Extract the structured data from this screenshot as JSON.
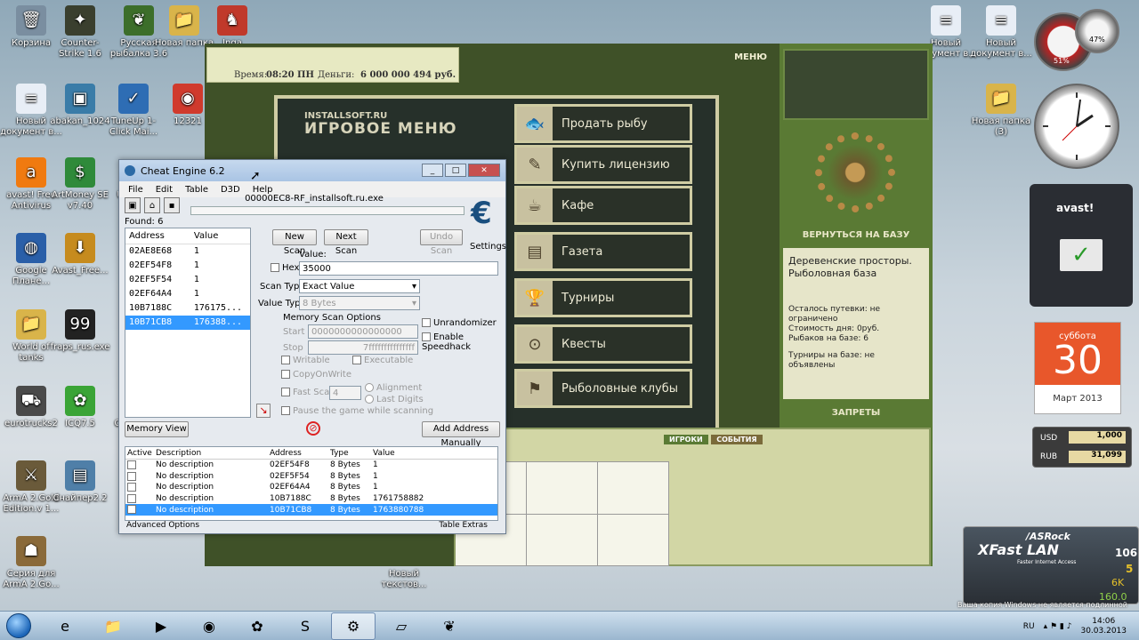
{
  "desktop_icons": [
    {
      "label": "Корзина",
      "glyph": "🗑",
      "color": "#7a8ea0"
    },
    {
      "label": "Counter-Strike 1.6",
      "glyph": "✦",
      "color": "#3a3f2e"
    },
    {
      "label": "Русская рыбалка 3.6",
      "glyph": "❦",
      "color": "#3c6e2a"
    },
    {
      "label": "Новая папка",
      "glyph": "📁",
      "color": "#d9b44a"
    },
    {
      "label": "Inga",
      "glyph": "♞",
      "color": "#c0392b"
    },
    {
      "label": "Новый документ в...",
      "glyph": "≡",
      "color": "#e8eef6"
    },
    {
      "label": "abakan_1024",
      "glyph": "▣",
      "color": "#3a7ca8"
    },
    {
      "label": "TuneUp 1-Click Mai...",
      "glyph": "✓",
      "color": "#2e6db4"
    },
    {
      "label": "12321",
      "glyph": "◉",
      "color": "#d03a2d"
    },
    {
      "label": "avast! Free Antivirus",
      "glyph": "a",
      "color": "#f07a10"
    },
    {
      "label": "ArtMoney SE v7.40",
      "glyph": "$",
      "color": "#2f8a3a"
    },
    {
      "label": "U",
      "glyph": "",
      "color": "transparent"
    },
    {
      "label": "Google Плане...",
      "glyph": "◍",
      "color": "#2a5fa8"
    },
    {
      "label": "Avast_Free...",
      "glyph": "⬇",
      "color": "#c68b1e"
    },
    {
      "label": "World of tanks",
      "glyph": "📁",
      "color": "#d9b44a"
    },
    {
      "label": "fraps_rus.exe",
      "glyph": "99",
      "color": "#222"
    },
    {
      "label": "eurotrucks2",
      "glyph": "⛟",
      "color": "#4a4a4a"
    },
    {
      "label": "ICQ7.5",
      "glyph": "✿",
      "color": "#3aa436"
    },
    {
      "label": "Ch",
      "glyph": "",
      "color": "transparent"
    },
    {
      "label": "ArmA 2.Gold Edition.v 1...",
      "glyph": "⚔",
      "color": "#6a5a3a"
    },
    {
      "label": "Снайпер2.2",
      "glyph": "▤",
      "color": "#4f7fa8"
    },
    {
      "label": "Серия для ArmA 2.Go...",
      "glyph": "☗",
      "color": "#8a6a3a"
    },
    {
      "label": "Новый текстов...",
      "glyph": "≡",
      "color": "#e8eef6"
    },
    {
      "label": "Новый документ в...",
      "glyph": "≡",
      "color": "#e8eef6"
    },
    {
      "label": "Новый документ в...",
      "glyph": "≡",
      "color": "#e8eef6"
    },
    {
      "label": "Новая папка (3)",
      "glyph": "📁",
      "color": "#d9b44a"
    }
  ],
  "game": {
    "time_label": "Время:",
    "time_value": "08:20 ПН",
    "money_label": "Деньги:",
    "money_value": "6 000 000 494 руб.",
    "menu_label": "МЕНЮ",
    "logo_small": "INSTALLSOFT.RU",
    "logo_big": "ИГРОВОЕ МЕНЮ",
    "menu_items": [
      "Продать рыбу",
      "Купить лицензию",
      "Кафе",
      "Газета",
      "Турниры",
      "Квесты",
      "Рыболовные клубы"
    ],
    "menu_glyphs": [
      "🐟",
      "✎",
      "☕",
      "▤",
      "🏆",
      "⊙",
      "⚑"
    ],
    "return_label": "ВЕРНУТЬСЯ НА БАЗУ",
    "base_title": "Деревенские просторы. Рыболовная база",
    "base_lines": [
      "Осталось путевки: не ограничено",
      "Стоимость дня: 0руб.",
      "Рыбаков на базе: 6",
      "Турниры на базе: не объявлены"
    ],
    "bans_label": "ЗАПРЕТЫ",
    "tab_players": "ИГРОКИ",
    "tab_events": "СОБЫТИЯ"
  },
  "cheat_engine": {
    "title": "Cheat Engine 6.2",
    "menu": [
      "File",
      "Edit",
      "Table",
      "D3D",
      "Help"
    ],
    "process": "00000EC8-RF_installsoft.ru.exe",
    "found": "Found: 6",
    "list_header": {
      "address": "Address",
      "value": "Value"
    },
    "results": [
      {
        "address": "02AE8E68",
        "value": "1"
      },
      {
        "address": "02EF54F8",
        "value": "1"
      },
      {
        "address": "02EF5F54",
        "value": "1"
      },
      {
        "address": "02EF64A4",
        "value": "1"
      },
      {
        "address": "10B7188C",
        "value": "176175..."
      },
      {
        "address": "10B71CB8",
        "value": "176388..."
      }
    ],
    "new_scan": "New Scan",
    "next_scan": "Next Scan",
    "undo_scan": "Undo Scan",
    "settings": "Settings",
    "value_label": "Value:",
    "hex_label": "Hex",
    "value_input": "35000",
    "scan_type_label": "Scan Type",
    "scan_type": "Exact Value",
    "value_type_label": "Value Type",
    "value_type": "8 Bytes",
    "memory_options": "Memory Scan Options",
    "start_label": "Start",
    "start_value": "0000000000000000",
    "stop_label": "Stop",
    "stop_value": "7fffffffffffffff",
    "writable": "Writable",
    "executable": "Executable",
    "copyonwrite": "CopyOnWrite",
    "fast_scan": "Fast Scan",
    "fast_value": "4",
    "alignment": "Alignment",
    "last_digits": "Last Digits",
    "pause": "Pause the game while scanning",
    "unrandomizer": "Unrandomizer",
    "speedhack": "Enable Speedhack",
    "memory_view": "Memory View",
    "add_manual": "Add Address Manually",
    "table_header": [
      "Active",
      "Description",
      "Address",
      "Type",
      "Value"
    ],
    "table_rows": [
      {
        "desc": "No description",
        "address": "02EF54F8",
        "type": "8 Bytes",
        "value": "1"
      },
      {
        "desc": "No description",
        "address": "02EF5F54",
        "type": "8 Bytes",
        "value": "1"
      },
      {
        "desc": "No description",
        "address": "02EF64A4",
        "type": "8 Bytes",
        "value": "1"
      },
      {
        "desc": "No description",
        "address": "10B7188C",
        "type": "8 Bytes",
        "value": "1761758882"
      },
      {
        "desc": "No description",
        "address": "10B71CB8",
        "type": "8 Bytes",
        "value": "1763880788"
      }
    ],
    "advanced": "Advanced Options",
    "table_extras": "Table Extras"
  },
  "gadgets": {
    "cpu_pct": "51%",
    "ram_pct": "47%",
    "avast_label": "avast!",
    "cal_day": "суббота",
    "cal_date": "30",
    "cal_month": "Март 2013",
    "usd_label": "USD",
    "usd_value": "1,000",
    "rub_label": "RUB",
    "rub_value": "31,099",
    "asrock_brand": "/ASRock",
    "asrock_title": "XFast LAN",
    "asrock_sub": "Faster Internet Access",
    "asrock_n1": "106",
    "asrock_n2": "5",
    "asrock_n3": "6K",
    "asrock_n4": "160.0"
  },
  "taskbar": {
    "buttons": [
      "e",
      "📁",
      "▶",
      "◉",
      "✿",
      "S",
      "⚙",
      "▱",
      "❦"
    ],
    "lang": "RU",
    "time": "14:06",
    "date": "30.03.2013",
    "watermark": "Ваша копия Windows не является подлинной"
  }
}
